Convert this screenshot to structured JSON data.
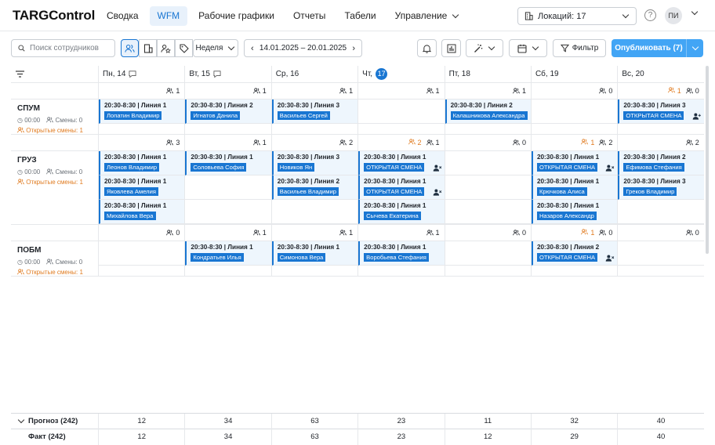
{
  "app": {
    "logo": "TARGControl"
  },
  "nav": [
    {
      "label": "Сводка",
      "active": false
    },
    {
      "label": "WFM",
      "active": true
    },
    {
      "label": "Рабочие графики",
      "active": false
    },
    {
      "label": "Отчеты",
      "active": false
    },
    {
      "label": "Табели",
      "active": false
    },
    {
      "label": "Управление",
      "active": false,
      "dropdown": true
    }
  ],
  "location": {
    "label": "Локаций: 17"
  },
  "user": {
    "initials": "ПИ"
  },
  "toolbar": {
    "search_placeholder": "Поиск сотрудников",
    "period": "Неделя",
    "date_range": "14.01.2025 – 20.01.2025",
    "filter": "Фильтр",
    "publish": "Опубликовать (7)"
  },
  "days": [
    {
      "label": "Пн, 14",
      "comment": true
    },
    {
      "label": "Вт, 15",
      "comment": true
    },
    {
      "label": "Ср, 16",
      "comment": false
    },
    {
      "label": "Чт,",
      "today": "17"
    },
    {
      "label": "Пт, 18"
    },
    {
      "label": "Сб, 19"
    },
    {
      "label": "Вс, 20"
    }
  ],
  "groups": [
    {
      "name": "СПУМ",
      "time": "00:00",
      "shifts": "Смены: 0",
      "open": "Открытые смены: 1",
      "counts": [
        {
          "open": "",
          "n": "1"
        },
        {
          "open": "",
          "n": "1"
        },
        {
          "open": "",
          "n": "1"
        },
        {
          "open": "",
          "n": "1"
        },
        {
          "open": "",
          "n": "1"
        },
        {
          "open": "",
          "n": "0"
        },
        {
          "open": "1",
          "n": "0"
        }
      ],
      "rows": [
        [
          {
            "time": "20:30-8:30 | Линия 1",
            "name": "Лопатин Владимир"
          },
          {
            "time": "20:30-8:30 | Линия 2",
            "name": "Игнатов Данила"
          },
          {
            "time": "20:30-8:30 | Линия 3",
            "name": "Васильев Сергей"
          },
          null,
          {
            "time": "20:30-8:30 | Линия 2",
            "name": "Калашникова Александра"
          },
          null,
          {
            "time": "20:30-8:30 | Линия 3",
            "name": "ОТКРЫТАЯ СМЕНА",
            "icon": "assign"
          }
        ]
      ]
    },
    {
      "name": "ГРУЗ",
      "time": "00:00",
      "shifts": "Смены: 0",
      "open": "Открытые смены: 1",
      "counts": [
        {
          "open": "",
          "n": "3"
        },
        {
          "open": "",
          "n": "1"
        },
        {
          "open": "",
          "n": "2"
        },
        {
          "open": "2",
          "n": "1"
        },
        {
          "open": "",
          "n": "0"
        },
        {
          "open": "1",
          "n": "2"
        },
        {
          "open": "",
          "n": "2"
        }
      ],
      "rows": [
        [
          {
            "time": "20:30-8:30 | Линия 1",
            "name": "Леонов Владимир"
          },
          {
            "time": "20:30-8:30 | Линия 1",
            "name": "Соловьева София"
          },
          {
            "time": "20:30-8:30 | Линия 3",
            "name": "Новиков Ян"
          },
          {
            "time": "20:30-8:30 | Линия 1",
            "name": "ОТКРЫТАЯ СМЕНА",
            "icon": "remove"
          },
          null,
          {
            "time": "20:30-8:30 | Линия 1",
            "name": "ОТКРЫТАЯ СМЕНА",
            "icon": "remove"
          },
          {
            "time": "20:30-8:30 | Линия 2",
            "name": "Ефимова Стефания"
          }
        ],
        [
          {
            "time": "20:30-8:30 | Линия 1",
            "name": "Яковлева Амелия"
          },
          null,
          {
            "time": "20:30-8:30 | Линия 2",
            "name": "Васильев Владимир"
          },
          {
            "time": "20:30-8:30 | Линия 1",
            "name": "ОТКРЫТАЯ СМЕНА",
            "icon": "remove"
          },
          null,
          {
            "time": "20:30-8:30 | Линия 1",
            "name": "Крючкова Алиса"
          },
          {
            "time": "20:30-8:30 | Линия 3",
            "name": "Греков Владимир"
          }
        ],
        [
          {
            "time": "20:30-8:30 | Линия 1",
            "name": "Михайлова Вера"
          },
          null,
          null,
          {
            "time": "20:30-8:30 | Линия 1",
            "name": "Сычева Екатерина"
          },
          null,
          {
            "time": "20:30-8:30 | Линия 1",
            "name": "Назаров Александр"
          },
          null
        ]
      ]
    },
    {
      "name": "ПОБМ",
      "time": "00:00",
      "shifts": "Смены: 0",
      "open": "Открытые смены: 1",
      "counts": [
        {
          "open": "",
          "n": "0"
        },
        {
          "open": "",
          "n": "1"
        },
        {
          "open": "",
          "n": "1"
        },
        {
          "open": "",
          "n": "1"
        },
        {
          "open": "",
          "n": "0"
        },
        {
          "open": "1",
          "n": "0"
        },
        {
          "open": "",
          "n": "0"
        }
      ],
      "rows": [
        [
          null,
          {
            "time": "20:30-8:30 | Линия 1",
            "name": "Кондратьев Илья"
          },
          {
            "time": "20:30-8:30 | Линия 1",
            "name": "Симонова Вера"
          },
          {
            "time": "20:30-8:30 | Линия 1",
            "name": "Воробьева Стефания"
          },
          null,
          {
            "time": "20:30-8:30 | Линия 2",
            "name": "ОТКРЫТАЯ СМЕНА",
            "icon": "remove"
          },
          null
        ]
      ]
    }
  ],
  "footer": {
    "forecast": {
      "label": "Прогноз (242)",
      "values": [
        "12",
        "34",
        "63",
        "23",
        "11",
        "32",
        "40"
      ]
    },
    "fact": {
      "label": "Факт (242)",
      "values": [
        "12",
        "34",
        "63",
        "23",
        "12",
        "29",
        "40"
      ]
    }
  }
}
